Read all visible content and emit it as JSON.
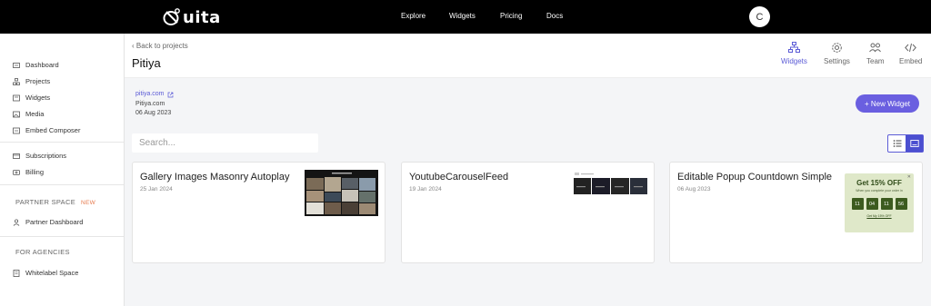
{
  "topbar": {
    "brand": "uita",
    "nav": [
      "Explore",
      "Widgets",
      "Pricing",
      "Docs"
    ],
    "avatar_initial": "C"
  },
  "sidebar": {
    "items": [
      "Dashboard",
      "Projects",
      "Widgets",
      "Media",
      "Embed Composer"
    ],
    "account_items": [
      "Subscriptions",
      "Billing"
    ],
    "partner_section": "PARTNER SPACE",
    "partner_badge": "NEW",
    "partner_items": [
      "Partner Dashboard"
    ],
    "agencies_section": "FOR AGENCIES",
    "agencies_items": [
      "Whitelabel Space"
    ]
  },
  "header": {
    "back_label": "Back to projects",
    "title": "Pitiya",
    "tools": [
      "Widgets",
      "Settings",
      "Team",
      "Embed"
    ],
    "active_tool": "Widgets"
  },
  "project": {
    "domain": "pitiya.com",
    "name": "Pitiya.com",
    "created": "06 Aug 2023",
    "new_widget_label": "+ New Widget"
  },
  "search": {
    "placeholder": "Search..."
  },
  "widgets": [
    {
      "title": "Gallery Images Masonry Autoplay",
      "date": "25 Jan 2024"
    },
    {
      "title": "YoutubeCarouselFeed",
      "date": "19 Jan 2024"
    },
    {
      "title": "Editable Popup Countdown Simple",
      "date": "06 Aug 2023"
    }
  ],
  "popup_preview": {
    "headline": "Get 15% OFF",
    "subtext": "When you complete your order in",
    "countdown": [
      "11",
      "04",
      "11",
      "56"
    ],
    "cta": "Get My 15% OFF"
  },
  "colors": {
    "accent": "#5b5bd6",
    "button": "#6a5fe0",
    "topbar": "#000000"
  }
}
